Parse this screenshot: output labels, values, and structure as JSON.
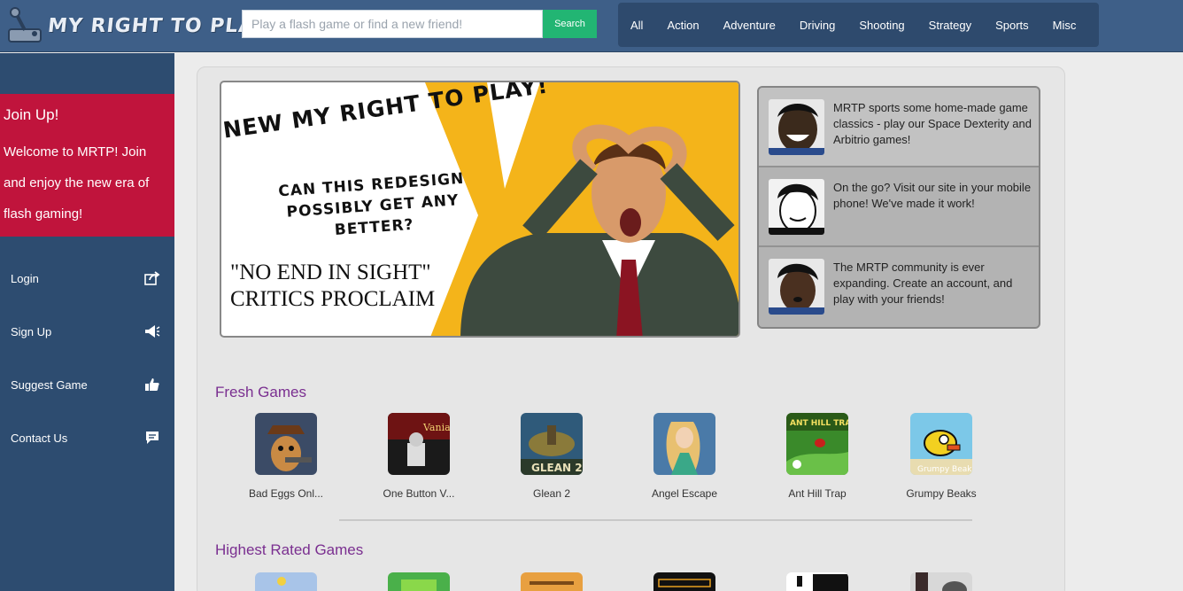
{
  "header": {
    "logo_text": "MY RIGHT TO PLAY",
    "search_placeholder": "Play a flash game or find a new friend!",
    "search_button": "Search",
    "categories": [
      "All",
      "Action",
      "Adventure",
      "Driving",
      "Shooting",
      "Strategy",
      "Sports",
      "Misc"
    ]
  },
  "sidebar": {
    "join_title": "Join Up!",
    "join_text": "Welcome to MRTP! Join and enjoy the new era of flash gaming!",
    "items": [
      {
        "label": "Login",
        "icon": "share-icon"
      },
      {
        "label": "Sign Up",
        "icon": "megaphone-icon"
      },
      {
        "label": "Suggest Game",
        "icon": "thumbs-up-icon"
      },
      {
        "label": "Contact Us",
        "icon": "chat-icon"
      }
    ]
  },
  "hero": {
    "line1": "NEW MY RIGHT TO PLAY!",
    "line2": "CAN THIS REDESIGN POSSIBLY GET ANY BETTER?",
    "line3": "\"NO END IN SIGHT\" CRITICS PROCLAIM"
  },
  "news": [
    {
      "text": "MRTP sports some home-made game classics - play our Space Dexterity and Arbitrio games!"
    },
    {
      "text": "On the go? Visit our site in your mobile phone! We've made it work!"
    },
    {
      "text": "The MRTP community is ever expanding. Create an account, and play with your friends!"
    }
  ],
  "fresh_games": {
    "title": "Fresh Games",
    "games": [
      {
        "title": "Bad Eggs Onl..."
      },
      {
        "title": "One Button V..."
      },
      {
        "title": "Glean 2"
      },
      {
        "title": "Angel Escape"
      },
      {
        "title": "Ant Hill Trap"
      },
      {
        "title": "Grumpy Beaks"
      }
    ]
  },
  "highest_rated": {
    "title": "Highest Rated Games"
  },
  "colors": {
    "header_bg": "#3e5f88",
    "sidebar_bg": "#2d4c70",
    "join_bg": "#c0143c",
    "search_button": "#22b573",
    "section_title": "#7a2f90"
  }
}
